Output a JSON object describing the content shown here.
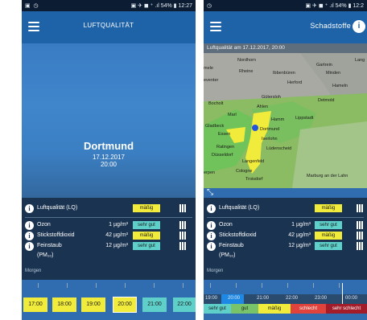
{
  "left": {
    "status": {
      "left": "▣ ◷",
      "right": "▣ ✈ ◼ ⁺ .ıl 54% ▮ 12:27"
    },
    "title": "LUFTQUALITÄT",
    "city": "Dortmund",
    "date": "17.12.2017",
    "time": "20:00",
    "rows": [
      {
        "label": "Luftqualität (LQ)",
        "value": "",
        "badge": "mäßig"
      },
      {
        "label": "Ozon",
        "value": "1 µg/m³",
        "badge": "sehr gut"
      },
      {
        "label": "Stickstoffdioxid",
        "value": "42 µg/m³",
        "badge": "mäßig"
      },
      {
        "label": "Feinstaub",
        "value": "12 µg/m³",
        "badge": "sehr gut",
        "sub": "(PM₁₀)"
      }
    ],
    "morgen": "Morgen",
    "hours": [
      "17:00",
      "18:00",
      "19:00",
      "20:00",
      "21:00",
      "22:00"
    ]
  },
  "right": {
    "status": {
      "left": "◷",
      "right": "▣ ✈ ◼ ⁺ .ıl 54% ▮ 12:2"
    },
    "title": "Schadstoffe",
    "map_header": "Luftqualität am  17.12.2017, 20:00",
    "map_labels": [
      "Nordhorn",
      "Gartrein",
      "Lang",
      "mele",
      "Rheine",
      "Ibbenbüren",
      "Minden",
      "Herford",
      "Hameln",
      "eventer",
      "Gütersloh",
      "Detmold",
      "Bocholt",
      "Ahlen",
      "Marl",
      "Hamm",
      "Lippstadt",
      "Gladbeck",
      "Dortmund",
      "Essen",
      "Iserlohn",
      "Ratingen",
      "Lüdenscheid",
      "Düsseldorf",
      "Langenfeld",
      "Cologne",
      "Troisdorf",
      "Marburg an der Lahn",
      "erpen"
    ],
    "rows": [
      {
        "label": "Luftqualität (LQ)",
        "value": "",
        "badge": "mäßig"
      },
      {
        "label": "Ozon",
        "value": "1 µg/m³",
        "badge": "sehr gut"
      },
      {
        "label": "Stickstoffdioxid",
        "value": "42 µg/m³",
        "badge": "mäßig"
      },
      {
        "label": "Feinstaub",
        "value": "12 µg/m³",
        "badge": "sehr gut",
        "sub": "(PM₁₀)"
      }
    ],
    "morgen": "Morgen",
    "times": [
      "19:00",
      "20:00",
      "21:00",
      "22:00",
      "23:00",
      "00:00"
    ],
    "legend": [
      "sehr gut",
      "gut",
      "mäßig",
      "schlecht",
      "sehr schlecht"
    ]
  },
  "colors": {
    "yellow": "#f1ec3b",
    "teal": "#5ecfc9",
    "appbar": "#1e63a8",
    "panel": "#1a3350",
    "schlecht": "#e0433b",
    "sehr_schlecht": "#a31c2a"
  }
}
